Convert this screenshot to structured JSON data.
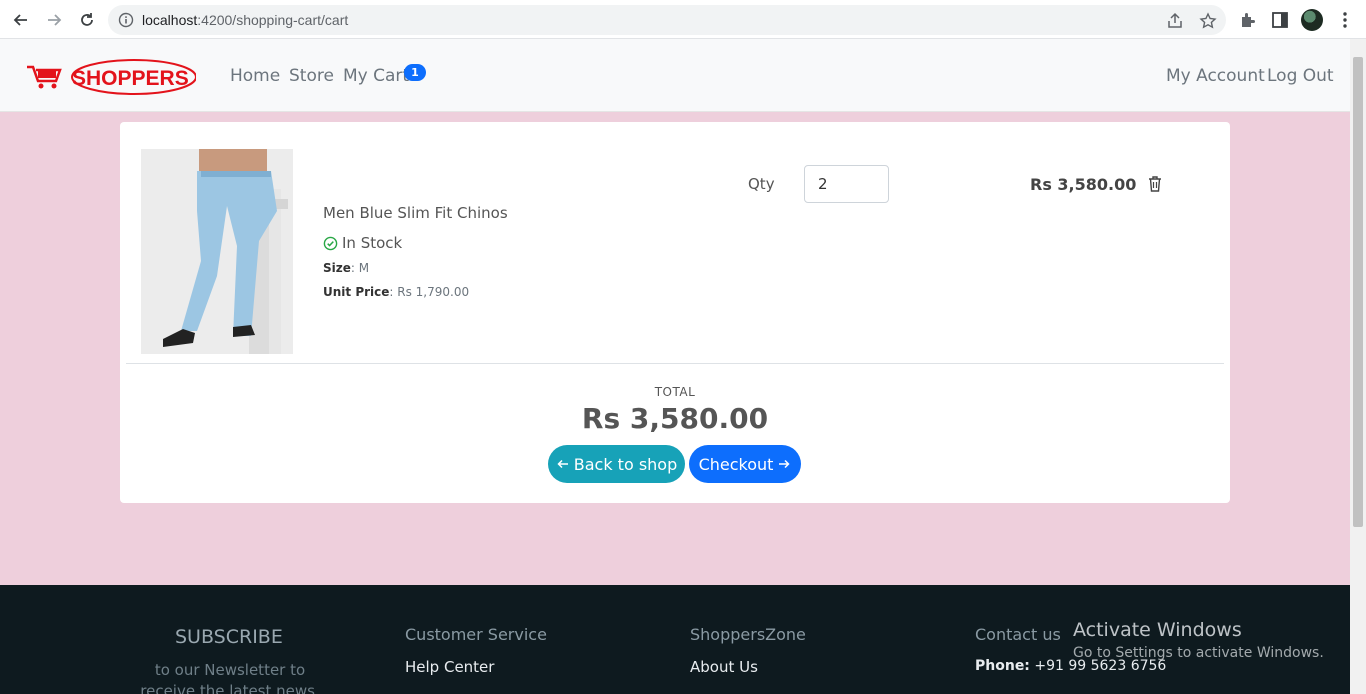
{
  "browser": {
    "url_host": "localhost",
    "url_path": ":4200/shopping-cart/cart"
  },
  "navbar": {
    "brand": "SHOPPERS",
    "links": [
      "Home",
      "Store",
      "My Cart"
    ],
    "cart_count": "1",
    "right_links": [
      "My Account",
      "Log Out"
    ]
  },
  "cart": {
    "item": {
      "name": "Men Blue Slim Fit Chinos",
      "stock": "In Stock",
      "size_label": "Size",
      "size_value": ": M",
      "unit_price_label": "Unit Price",
      "unit_price_value": ": Rs 1,790.00",
      "qty_label": "Qty",
      "qty_value": "2",
      "line_total": "Rs 3,580.00"
    },
    "total_label": "TOTAL",
    "total_value": "Rs 3,580.00",
    "back_button": "Back to shop",
    "checkout_button": "Checkout"
  },
  "footer": {
    "subscribe_title": "SUBSCRIBE",
    "subscribe_text": "to our Newsletter to receive the latest news, sales and",
    "customer_service_title": "Customer Service",
    "customer_service_links": [
      "Help Center"
    ],
    "zone_title": "ShoppersZone",
    "zone_links": [
      "About Us"
    ],
    "contact_title": "Contact us",
    "phone_label": "Phone:",
    "phone_value": " +91 99 5623 6756"
  },
  "watermark": {
    "title": "Activate Windows",
    "subtitle": "Go to Settings to activate Windows."
  },
  "colors": {
    "page_bg": "#eecfdc",
    "primary": "#0d6efd",
    "info": "#17a2b8",
    "brand_red": "#e3131b",
    "footer_bg": "#0e1a1f"
  }
}
